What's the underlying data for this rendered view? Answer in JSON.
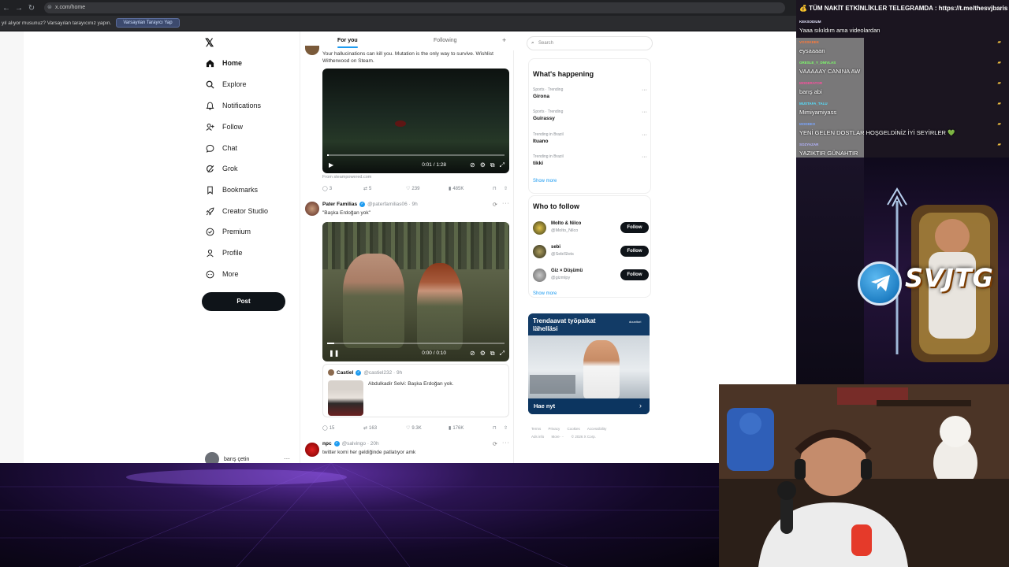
{
  "browser": {
    "url": "x.com/home",
    "infobar_text": "yıl alıyor musunuz? Varsayılan tarayıcınız yapın.",
    "infobar_button": "Varsayılan Tarayıcı Yap"
  },
  "sidebar": {
    "logo": "𝕏",
    "items": [
      {
        "label": "Home",
        "icon": "home-icon"
      },
      {
        "label": "Explore",
        "icon": "search-icon"
      },
      {
        "label": "Notifications",
        "icon": "bell-icon"
      },
      {
        "label": "Follow",
        "icon": "person-add-icon"
      },
      {
        "label": "Chat",
        "icon": "chat-icon"
      },
      {
        "label": "Grok",
        "icon": "grok-icon"
      },
      {
        "label": "Bookmarks",
        "icon": "bookmark-icon"
      },
      {
        "label": "Creator Studio",
        "icon": "rocket-icon"
      },
      {
        "label": "Premium",
        "icon": "premium-icon"
      },
      {
        "label": "Profile",
        "icon": "profile-icon"
      },
      {
        "label": "More",
        "icon": "more-icon"
      }
    ],
    "post_button": "Post",
    "account_name": "barış çetin"
  },
  "feed": {
    "tabs": {
      "for_you": "For you",
      "following": "Following"
    },
    "tweet1": {
      "text": "Your hallucinations can kill you. Mutation is the only way to survive. Wishlist Witherwood on Steam.",
      "video_time": "0:01 / 1:28",
      "video_progress": 0.01,
      "source": "From steampowered.com",
      "replies": "3",
      "reposts": "5",
      "likes": "239",
      "views": "485K"
    },
    "tweet2": {
      "name": "Pater Familias",
      "handle": "@paterfamilias06 · 9h",
      "text": "\"Başka Erdoğan yok\"",
      "video_time": "0:00 / 0:10",
      "video_progress": 0.04,
      "quote": {
        "name": "Castiel",
        "handle": "@castiel232 · 9h",
        "text": "Abdulkadir Selvi: Başka Erdoğan yok."
      },
      "replies": "15",
      "reposts": "163",
      "likes": "9.3K",
      "views": "176K"
    },
    "tweet3": {
      "name": "npc",
      "handle": "@salvingo · 20h",
      "text": "twitter komi her geldiğinde patlatıyor amk"
    }
  },
  "right": {
    "search_placeholder": "Search",
    "happening_title": "What's happening",
    "trends": [
      {
        "category": "Sports · Trending",
        "name": "Girona"
      },
      {
        "category": "Sports · Trending",
        "name": "Guirassy"
      },
      {
        "category": "Trending in Brazil",
        "name": "Ituano"
      },
      {
        "category": "Trending in Brazil",
        "name": "tikki"
      }
    ],
    "show_more": "Show more",
    "who_title": "Who to follow",
    "follow_suggestions": [
      {
        "name": "Molto & Nilco",
        "handle": "@Molto_Nilco"
      },
      {
        "name": "sebi",
        "handle": "@SebiSlots"
      },
      {
        "name": "Giz × Düşümü",
        "handle": "@gizmlpy"
      }
    ],
    "follow_label": "Follow",
    "ad_title": "Trendaavat työpaikat lähelläsi",
    "ad_brand": "duunitori",
    "ad_cta": "Hae nyt",
    "footer": [
      "Terms",
      "Privacy",
      "Cookies",
      "Accessibility",
      "Ads info",
      "More ···",
      "© 2026 X Corp."
    ]
  },
  "stream": {
    "banner": "💰 TÜM NAKİT ETKİNLİKLER TELEGRAMDA : https://t.me/thesvjbaris",
    "logo_text": "SVJTG",
    "chat": [
      {
        "user": "KEKSODIUM",
        "text": "Yaaa sıkıldım ama videolardan",
        "color": "#e6e6ff"
      },
      {
        "user": "VOSSKEEK",
        "text": "eysaaaan",
        "color": "#ff7a3a"
      },
      {
        "user": "GRESLE_Y_DNIVLAS",
        "text": "VAAAAAY CANINA AW",
        "color": "#7dff6a"
      },
      {
        "user": "MODERATOR",
        "text": "barış abi",
        "color": "#ff4fa0"
      },
      {
        "user": "MUSTAFA_TALU",
        "text": "Mimiyamiyass",
        "color": "#54e0ff"
      },
      {
        "user": "MODBEO",
        "text": "YENİ GELEN DOSTLAR HOŞGELDİNİZ İYİ SEYİRLER 💚",
        "color": "#7aa6ff"
      },
      {
        "user": "SOZYAZAR",
        "text": "YAZIKTIR GÜNAHTIR",
        "color": "#b3b3ff"
      }
    ]
  }
}
